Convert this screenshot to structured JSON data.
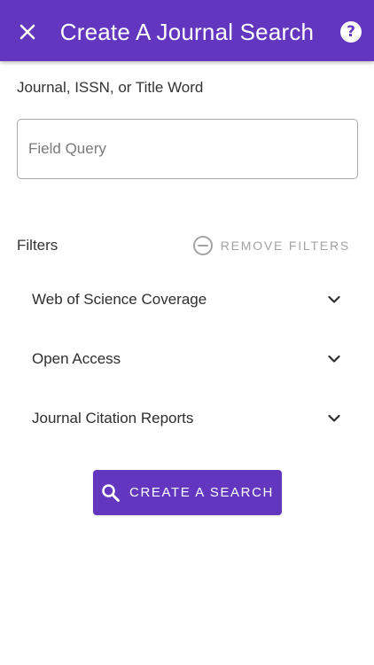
{
  "header": {
    "title": "Create A Journal Search",
    "close_icon": "close-icon",
    "help_icon": "help-icon",
    "help_glyph": "?",
    "bg_color": "#6236be"
  },
  "query": {
    "label": "Journal, ISSN, or Title Word",
    "placeholder": "Field Query",
    "value": ""
  },
  "filters": {
    "title": "Filters",
    "remove_label": "REMOVE FILTERS",
    "remove_icon": "minus-circle-icon",
    "items": [
      {
        "label": "Web of Science Coverage",
        "icon": "chevron-down-icon"
      },
      {
        "label": "Open Access",
        "icon": "chevron-down-icon"
      },
      {
        "label": "Journal Citation Reports",
        "icon": "chevron-down-icon"
      }
    ]
  },
  "action": {
    "label": "CREATE A SEARCH",
    "icon": "search-icon"
  }
}
